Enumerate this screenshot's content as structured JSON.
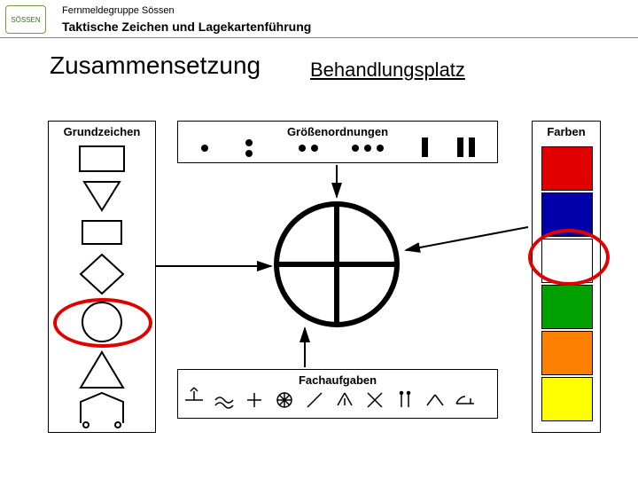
{
  "header": {
    "org": "Fernmeldegruppe Sössen",
    "subject": "Taktische Zeichen und Lagekartenführung",
    "logo_text": "SÖSSEN"
  },
  "title": "Zusammensetzung",
  "subtitle": "Behandlungsplatz",
  "panels": {
    "grundzeichen": "Grundzeichen",
    "groessenordnungen": "Größenordnungen",
    "fachaufgaben": "Fachaufgaben",
    "farben": "Farben"
  },
  "colors": {
    "red": "#e00000",
    "blue": "#0000a8",
    "white": "#ffffff",
    "green": "#00a000",
    "orange": "#ff8000",
    "yellow": "#ffff00"
  },
  "chart_data": {
    "type": "table",
    "title": "Zusammensetzung taktischer Zeichen — Beispiel Behandlungsplatz",
    "components": {
      "grundzeichen_shapes": [
        "rechteck-quer",
        "dreieck-nach-unten",
        "rechteck-klein",
        "raute",
        "kreis",
        "dreieck-nach-oben",
        "fuenfeck-zelt"
      ],
      "groessenordnungen_symbols": [
        "punkt-1",
        "punkt-2-vertikal",
        "punkt-2-horizontal",
        "punkt-3-horizontal",
        "balken-1",
        "balken-2"
      ],
      "fachaufgaben_icons": [
        "antenne",
        "wellen",
        "kreuz",
        "rad",
        "schraeg",
        "zelt",
        "werkzeug-kreuz",
        "doppelstrich",
        "dach",
        "liege"
      ],
      "farben_list": [
        "rot",
        "blau",
        "weiss",
        "gruen",
        "orange",
        "gelb"
      ]
    },
    "central_symbol": "Kreis mit Kreuz (Behandlungsplatz)",
    "highlighted": {
      "grundzeichen": "kreis",
      "farbe": "weiss"
    },
    "arrows": [
      "Grundzeichen → Zentrum",
      "Größenordnungen → Zentrum",
      "Fachaufgaben → Zentrum",
      "Farben → Zentrum"
    ]
  }
}
